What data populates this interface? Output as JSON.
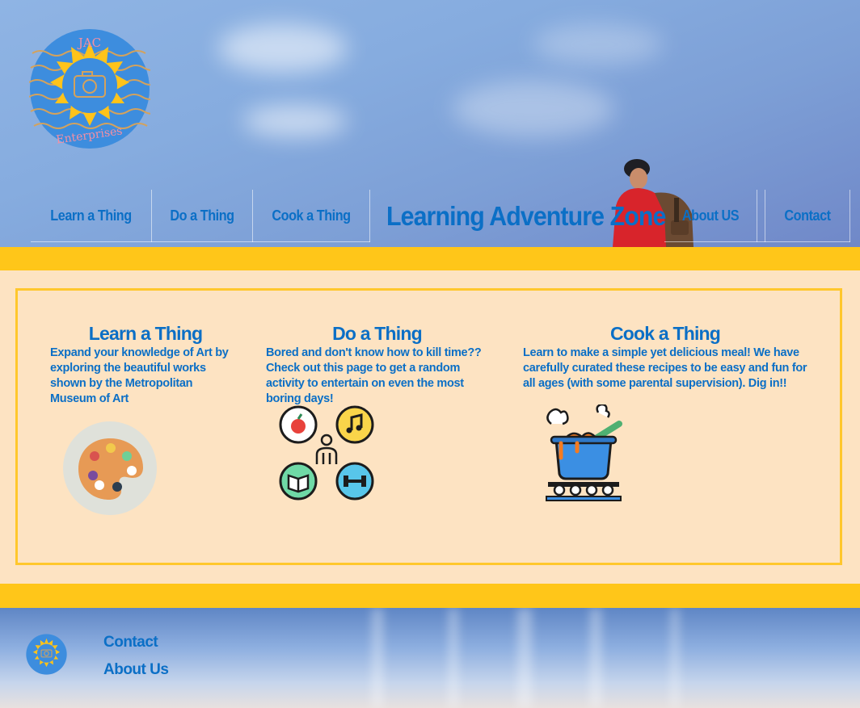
{
  "brand": {
    "logo_top_text": "JAC",
    "logo_bottom_text": "Enterprises",
    "site_title": "Learning Adventure Zone"
  },
  "nav": {
    "learn": "Learn a Thing",
    "do": "Do a Thing",
    "cook": "Cook a Thing",
    "about": "About US",
    "contact": "Contact"
  },
  "cards": [
    {
      "title": "Learn a Thing",
      "description": "Expand your knowledge of Art by exploring the beautiful works shown by the Metropolitan Museum of Art",
      "icon": "palette-icon"
    },
    {
      "title": "Do a Thing",
      "description": "Bored and don't know how to kill time?? Check out this page to get a random activity to entertain on even the most boring days!",
      "icon": "activities-icon"
    },
    {
      "title": "Cook a Thing",
      "description": "Learn to make a simple yet delicious meal! We have carefully curated these recipes to be easy and fun for all ages (with some parental supervision). Dig in!!",
      "icon": "cooking-pot-icon"
    }
  ],
  "footer": {
    "contact": "Contact",
    "about": "About Us"
  },
  "colors": {
    "accent_blue": "#0b6fc6",
    "band_yellow": "#ffc619",
    "card_bg": "#fde3c2"
  }
}
